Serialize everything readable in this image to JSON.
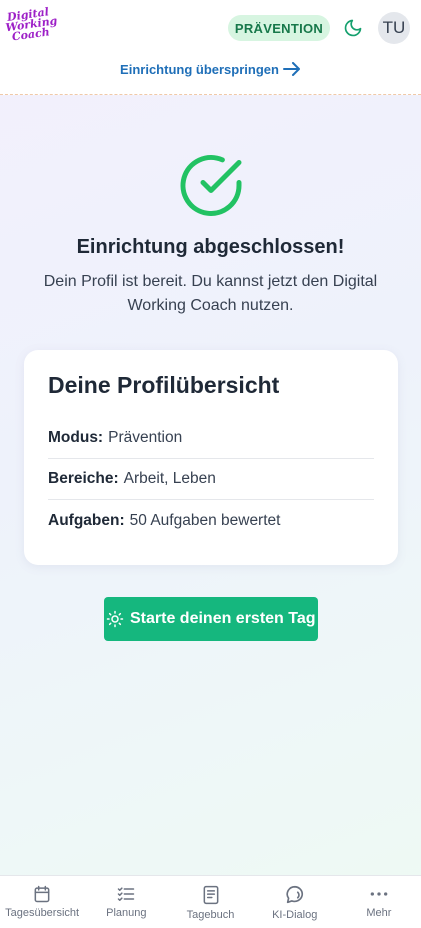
{
  "header": {
    "logo_lines": [
      "Digital",
      "Working",
      "Coach"
    ],
    "mode_badge": "PRÄVENTION",
    "avatar_initials": "TU",
    "skip_link": "Einrichtung überspringen"
  },
  "success": {
    "title": "Einrichtung abgeschlossen!",
    "message": "Dein Profil ist bereit. Du kannst jetzt den Digital Working Coach nutzen."
  },
  "profile_card": {
    "title": "Deine Profilübersicht",
    "rows": [
      {
        "label": "Modus:",
        "value": "Prävention"
      },
      {
        "label": "Bereiche:",
        "value": "Arbeit, Leben"
      },
      {
        "label": "Aufgaben:",
        "value": "50 Aufgaben bewertet"
      }
    ]
  },
  "cta": {
    "label": "Starte deinen ersten Tag"
  },
  "bottom_nav": [
    {
      "label": "Tagesübersicht",
      "icon": "calendar-icon"
    },
    {
      "label": "Planung",
      "icon": "checklist-icon"
    },
    {
      "label": "Tagebuch",
      "icon": "book-icon"
    },
    {
      "label": "KI-Dialog",
      "icon": "chat-icon"
    },
    {
      "label": "Mehr",
      "icon": "more-icon"
    }
  ],
  "colors": {
    "brand": "#15b77e",
    "badge_bg": "#d7f5e1",
    "logo": "#9d1fc7",
    "link": "#1f6fb8"
  }
}
